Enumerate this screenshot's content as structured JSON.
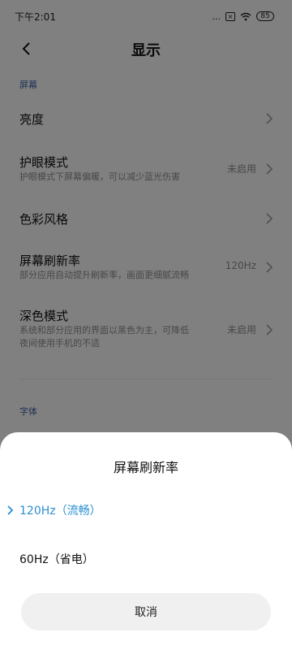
{
  "status_bar": {
    "time": "下午2:01",
    "dots": "...",
    "sim": "×",
    "battery": "85"
  },
  "header": {
    "title": "显示"
  },
  "sections": {
    "screen_label": "屏幕",
    "font_label": "字体"
  },
  "rows": {
    "brightness": {
      "title": "亮度"
    },
    "eye_care": {
      "title": "护眼模式",
      "subtitle": "护眼模式下屏幕偏暖，可以减少蓝光伤害",
      "value": "未启用"
    },
    "color_style": {
      "title": "色彩风格"
    },
    "refresh_rate": {
      "title": "屏幕刷新率",
      "subtitle": "部分应用自动提升刷新率，画面更细腻流畅",
      "value": "120Hz"
    },
    "dark_mode": {
      "title": "深色模式",
      "subtitle_line1": "系统和部分应用的界面以黑色为主，可降低",
      "subtitle_line2": "夜间使用手机的不适",
      "value": "未启用"
    }
  },
  "sheet": {
    "title": "屏幕刷新率",
    "options": [
      {
        "label": "120Hz（流畅）",
        "selected": true
      },
      {
        "label": "60Hz（省电）",
        "selected": false
      }
    ],
    "cancel_label": "取消"
  },
  "colors": {
    "accent": "#2a8fd0",
    "section_label": "#3b5fa6",
    "dim_overlay": "rgba(0,0,0,0.48)"
  },
  "icons": [
    "chevron-left-icon",
    "chevron-right-icon",
    "check-icon",
    "wifi-icon",
    "battery-icon"
  ]
}
